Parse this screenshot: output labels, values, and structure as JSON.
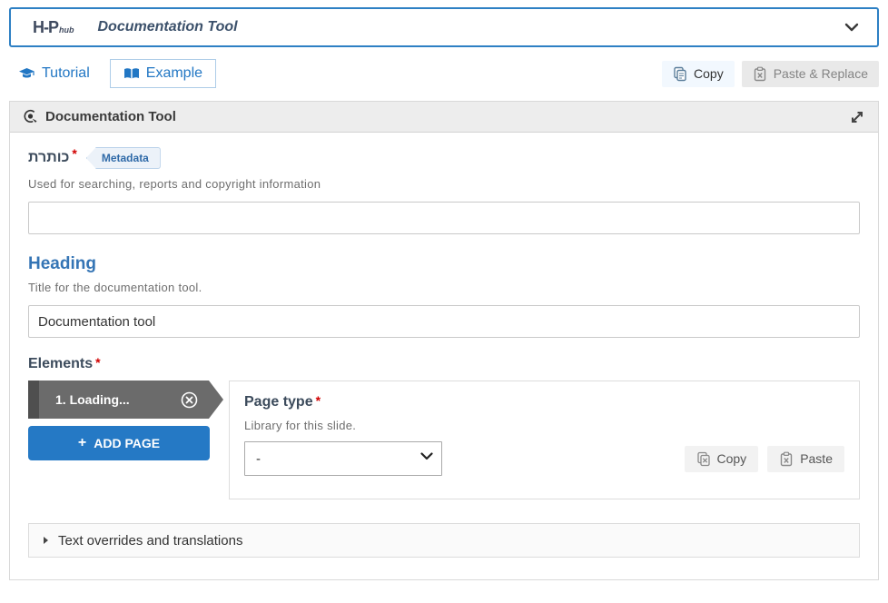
{
  "hub_bar": {
    "logo_main": "H-P",
    "logo_sub": "hub",
    "title": "Documentation Tool"
  },
  "toolbar": {
    "tutorial_label": "Tutorial",
    "example_label": "Example",
    "copy_label": "Copy",
    "paste_replace_label": "Paste & Replace"
  },
  "editor": {
    "header_title": "Documentation Tool",
    "fields": {
      "title": {
        "label": "כותרת",
        "required_mark": "*",
        "metadata_label": "Metadata",
        "description": "Used for searching, reports and copyright information",
        "value": ""
      },
      "heading": {
        "label": "Heading",
        "description": "Title for the documentation tool.",
        "value": "Documentation tool"
      },
      "elements": {
        "label": "Elements",
        "required_mark": "*",
        "pages": [
          {
            "tab_label": "1. Loading..."
          }
        ],
        "add_page_plus": "+",
        "add_page_label": "ADD PAGE",
        "page_type": {
          "label": "Page type",
          "required_mark": "*",
          "description": "Library for this slide.",
          "selected_option": "-",
          "copy_label": "Copy",
          "paste_label": "Paste"
        }
      }
    },
    "accordion_label": "Text overrides and translations"
  },
  "icons": {
    "hub-chevron": "chevron-down",
    "tutorial": "graduation-cap",
    "example": "open-book",
    "copy": "copy-documents",
    "paste": "clipboard-x",
    "content-type": "touch-interactive",
    "fullscreen": "diagonal-expand-arrows",
    "remove-page": "circle-x",
    "collapse": "triangle-right"
  },
  "colors": {
    "hub_border_blue": "#2e80c4",
    "link_blue": "#2277c4",
    "heading_blue": "#3575b5",
    "label_dark": "#3c4b5c",
    "required_red": "#d10000",
    "button_blue": "#2579c5",
    "tab_gray": "#6b6b6b",
    "tab_grip_gray": "#4f4f4f",
    "header_bar_gray": "#ededed"
  }
}
